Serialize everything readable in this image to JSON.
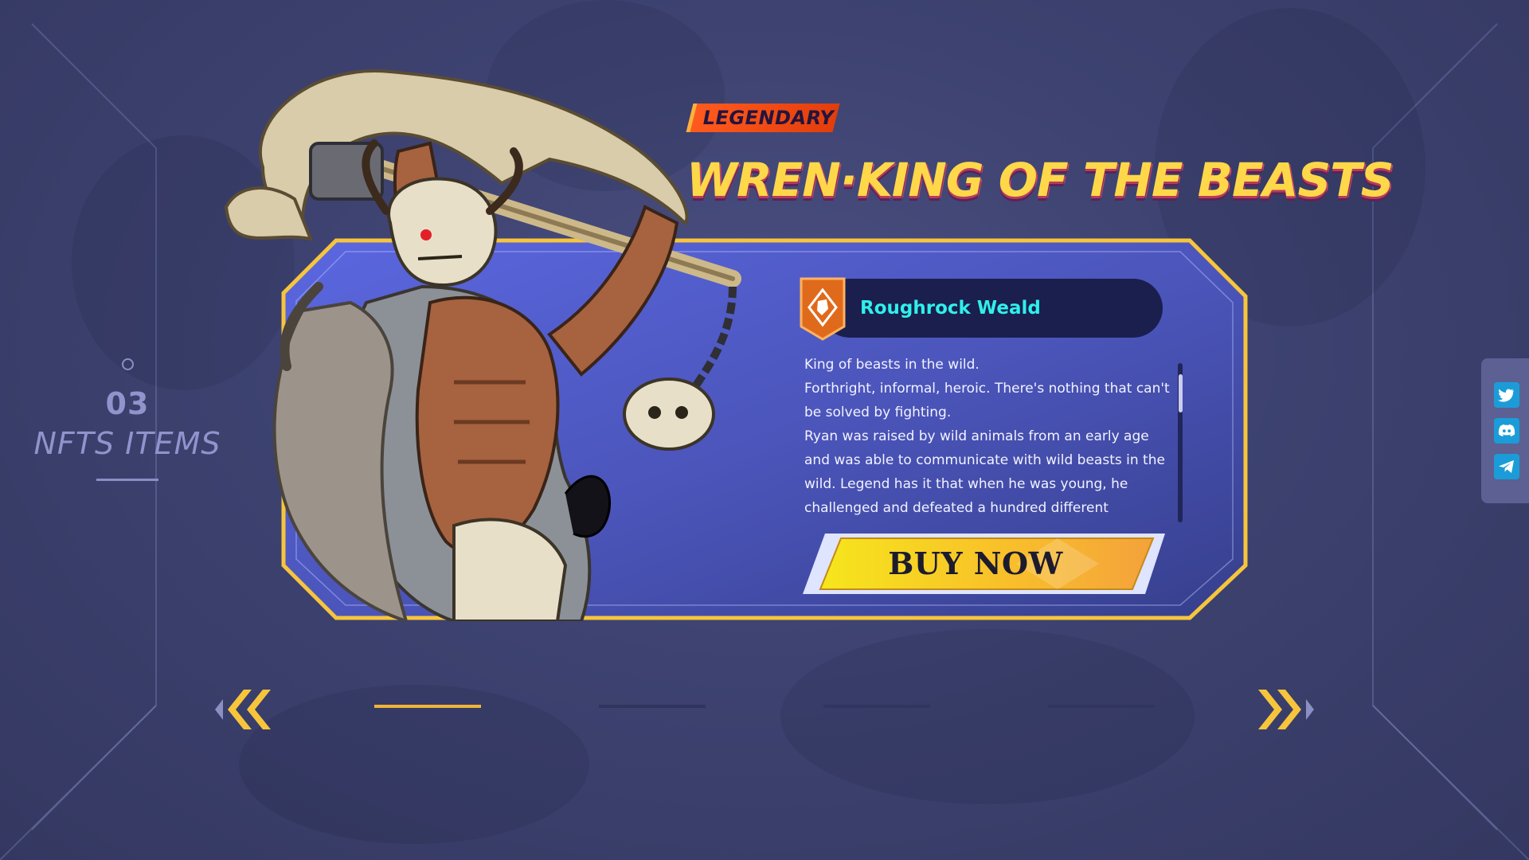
{
  "section": {
    "number": "03",
    "title": "NFTS ITEMS"
  },
  "hero": {
    "rarity": "LEGENDARY",
    "name": "WREN·KING OF THE BEASTS",
    "zone": "Roughrock Weald",
    "description": [
      "King of beasts in the wild.",
      "Forthright, informal, heroic. There's nothing that can't be solved by fighting.",
      "Ryan was raised by wild animals from an early age and was able to communicate with wild beasts in the wild. Legend has it that when he was young, he challenged and defeated a hundred different ferocious beasts"
    ]
  },
  "buy_button": {
    "label": "BUY NOW"
  },
  "pagination": {
    "total": 4,
    "active_index": 0
  },
  "social": [
    {
      "icon": "twitter-icon"
    },
    {
      "icon": "discord-icon"
    },
    {
      "icon": "telegram-icon"
    }
  ],
  "colors": {
    "accent_gold": "#f7c53c",
    "zone_cyan": "#2ff0ea",
    "rarity_orange": "#f0521a",
    "social_blue": "#1b9cd8"
  }
}
